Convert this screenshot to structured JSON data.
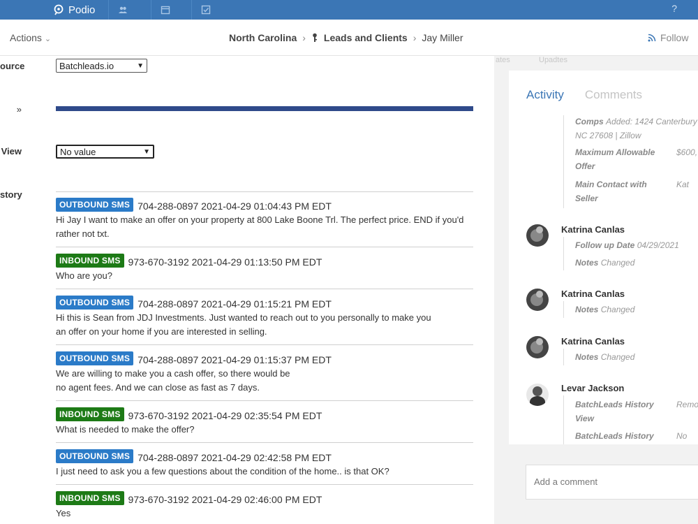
{
  "topbar": {
    "brand": "Podio",
    "icons": [
      "contacts-icon",
      "calendar-icon",
      "tasks-icon"
    ],
    "help": "?"
  },
  "subbar": {
    "actions": "Actions",
    "breadcrumb": [
      "North Carolina",
      "Leads and Clients",
      "Jay Miller"
    ],
    "follow": "Follow"
  },
  "labels": {
    "source": "ource",
    "chevrons": "»",
    "view": "View",
    "history": "story"
  },
  "fields": {
    "source_select": "Batchleads.io",
    "view_select": "No value"
  },
  "sms": [
    {
      "dir": "out",
      "badge": "OUTBOUND SMS",
      "phone_time": "704-288-0897 2021-04-29 01:04:43 PM EDT",
      "text": "Hi Jay I want to make an offer on your property at 800 Lake Boone Trl. The perfect price. END if you'd\nrather not txt."
    },
    {
      "dir": "in",
      "badge": "INBOUND SMS",
      "phone_time": "973-670-3192 2021-04-29 01:13:50 PM EDT",
      "text": "Who are you?"
    },
    {
      "dir": "out",
      "badge": "OUTBOUND SMS",
      "phone_time": "704-288-0897 2021-04-29 01:15:21 PM EDT",
      "text": "Hi this is Sean from JDJ Investments. Just wanted to reach out to you personally to make you\nan offer on your home if you are interested in selling."
    },
    {
      "dir": "out",
      "badge": "OUTBOUND SMS",
      "phone_time": "704-288-0897 2021-04-29 01:15:37 PM EDT",
      "text": "We are willing to make you a cash offer, so there would be\nno agent fees. And we can close as fast as 7 days."
    },
    {
      "dir": "in",
      "badge": "INBOUND SMS",
      "phone_time": "973-670-3192 2021-04-29 02:35:54 PM EDT",
      "text": "What is needed to make the offer?"
    },
    {
      "dir": "out",
      "badge": "OUTBOUND SMS",
      "phone_time": "704-288-0897 2021-04-29 02:42:58 PM EDT",
      "text": "I just need to ask you a few questions about the condition of the home.. is that OK?"
    },
    {
      "dir": "in",
      "badge": "INBOUND SMS",
      "phone_time": "973-670-3192 2021-04-29 02:46:00 PM EDT",
      "text": "Yes"
    }
  ],
  "activity": {
    "tabs": {
      "activity": "Activity",
      "comments": "Comments"
    },
    "faint_header": [
      "ates",
      "Upadtes"
    ],
    "top_fields": [
      {
        "key": "Comps",
        "val": "Added: 1424 Canterbury",
        "line2": "NC 27608 | Zillow"
      },
      {
        "key": "Maximum Allowable",
        "key2": "Offer",
        "val": "$600,"
      },
      {
        "key": "Main Contact with",
        "key2": "Seller",
        "val": "Kat"
      }
    ],
    "entries": [
      {
        "user": "Katrina Canlas",
        "fields": [
          {
            "key": "Follow up Date",
            "val": "04/29/2021"
          },
          {
            "key": "Notes",
            "val": "Changed"
          }
        ]
      },
      {
        "user": "Katrina Canlas",
        "fields": [
          {
            "key": "Notes",
            "val": "Changed"
          }
        ]
      },
      {
        "user": "Katrina Canlas",
        "fields": [
          {
            "key": "Notes",
            "val": "Changed"
          }
        ]
      },
      {
        "user": "Levar Jackson",
        "fields": [
          {
            "key": "BatchLeads History",
            "key2": "View",
            "val": "Remo"
          },
          {
            "key": "BatchLeads History",
            "val": "No va"
          }
        ]
      }
    ]
  },
  "comment": {
    "placeholder": "Add a comment"
  }
}
